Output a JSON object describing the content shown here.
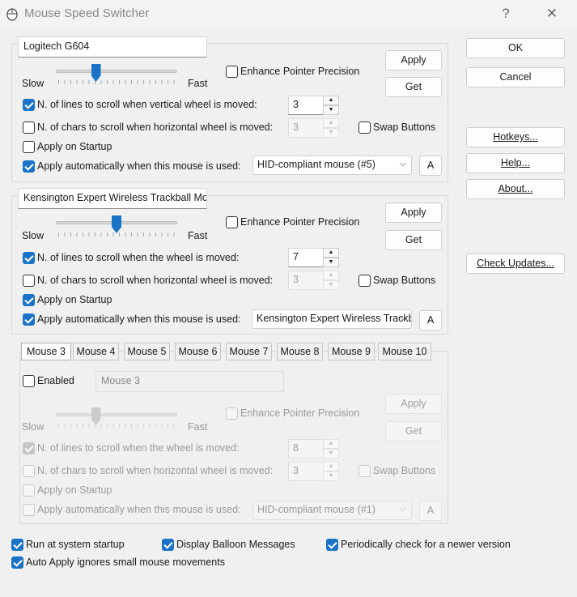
{
  "window": {
    "title": "Mouse Speed Switcher",
    "help_glyph": "?",
    "close_glyph": "✕"
  },
  "right_buttons": {
    "ok": "OK",
    "cancel": "Cancel",
    "hotkeys": "Hotkeys...",
    "help": "Help...",
    "about": "About...",
    "check_updates": "Check Updates..."
  },
  "common": {
    "slow": "Slow",
    "fast": "Fast",
    "apply": "Apply",
    "get": "Get",
    "a_button": "A",
    "enhance": "Enhance Pointer Precision",
    "swap": "Swap Buttons",
    "chars_scroll": "N. of chars to scroll when  horizontal wheel is moved:",
    "apply_on_startup": "Apply on Startup",
    "apply_auto": "Apply automatically when this mouse is used:"
  },
  "mouse1": {
    "name": "Logitech G604",
    "speed": 0.33,
    "lines_label": "N. of lines to scroll when vertical wheel is moved:",
    "lines_value": "3",
    "chars_value": "3",
    "device": "HID-compliant mouse (#5)",
    "enhance_checked": false,
    "lines_checked": true,
    "chars_checked": false,
    "swap_checked": false,
    "startup_checked": false,
    "auto_checked": true
  },
  "mouse2": {
    "name": "Kensington Expert Wireless Trackball Mouse",
    "speed": 0.5,
    "lines_label": "N. of lines to scroll when the wheel is moved:",
    "lines_value": "7",
    "chars_value": "3",
    "device": "Kensington Expert Wireless Trackball Mouse",
    "enhance_checked": false,
    "lines_checked": true,
    "chars_checked": false,
    "swap_checked": false,
    "startup_checked": true,
    "auto_checked": true
  },
  "tabs": [
    "Mouse 3",
    "Mouse 4",
    "Mouse 5",
    "Mouse 6",
    "Mouse 7",
    "Mouse 8",
    "Mouse 9",
    "Mouse 10"
  ],
  "mouse3": {
    "enabled_label": "Enabled",
    "enabled_checked": false,
    "name": "Mouse 3",
    "speed": 0.33,
    "lines_label": "N. of lines to scroll when the wheel is moved:",
    "lines_value": "8",
    "chars_value": "3",
    "device": "HID-compliant mouse (#1)",
    "lines_checked": true
  },
  "bottom": {
    "run_startup": "Run at system startup",
    "balloon": "Display Balloon Messages",
    "check_newer": "Periodically check for a newer version",
    "auto_apply": "Auto Apply ignores small mouse movements"
  },
  "colors": {
    "accent": "#1a73c7",
    "background": "#f0f0f0"
  }
}
